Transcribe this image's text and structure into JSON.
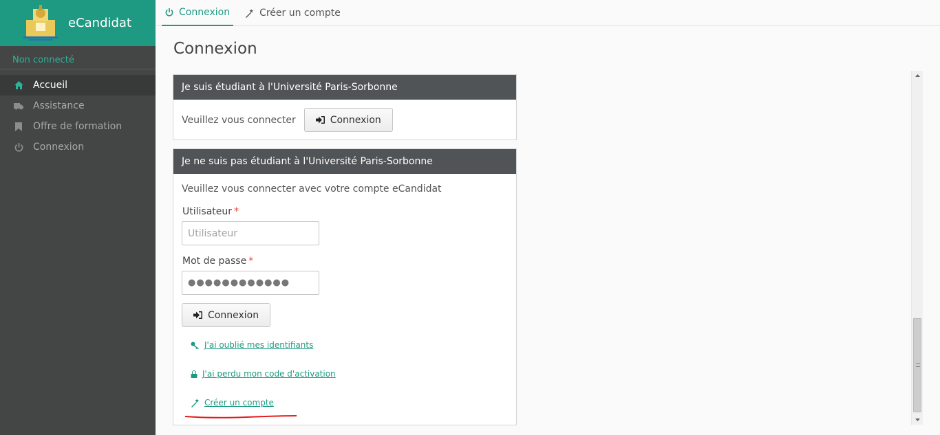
{
  "app": {
    "name": "eCandidat",
    "brand_color": "#1e9a82",
    "accent_color": "#2db39a"
  },
  "sidebar": {
    "user_state": "Non connecté",
    "items": [
      {
        "label": "Accueil",
        "icon": "home-icon",
        "active": true
      },
      {
        "label": "Assistance",
        "icon": "ambulance-icon",
        "active": false
      },
      {
        "label": "Offre de formation",
        "icon": "bookmark-icon",
        "active": false
      },
      {
        "label": "Connexion",
        "icon": "power-icon",
        "active": false
      }
    ]
  },
  "tabs": [
    {
      "label": "Connexion",
      "icon": "power-icon",
      "active": true
    },
    {
      "label": "Créer un compte",
      "icon": "magic-wand-icon",
      "active": false
    }
  ],
  "page": {
    "title": "Connexion"
  },
  "panel_student": {
    "header": "Je suis étudiant à l'Université Paris-Sorbonne",
    "prompt": "Veuillez vous connecter",
    "button_label": "Connexion"
  },
  "panel_other": {
    "header": "Je ne suis pas étudiant à l'Université Paris-Sorbonne",
    "intro": "Veuillez vous connecter avec votre compte eCandidat",
    "username_label": "Utilisateur",
    "username_placeholder": "Utilisateur",
    "password_label": "Mot de passe",
    "password_value": "●●●●●●●●●●●●",
    "required_mark": "*",
    "button_label": "Connexion",
    "links": {
      "forgot": "J'ai oublié mes identifiants",
      "lost_code": "J'ai perdu mon code d'activation",
      "create": "Créer un compte"
    }
  }
}
